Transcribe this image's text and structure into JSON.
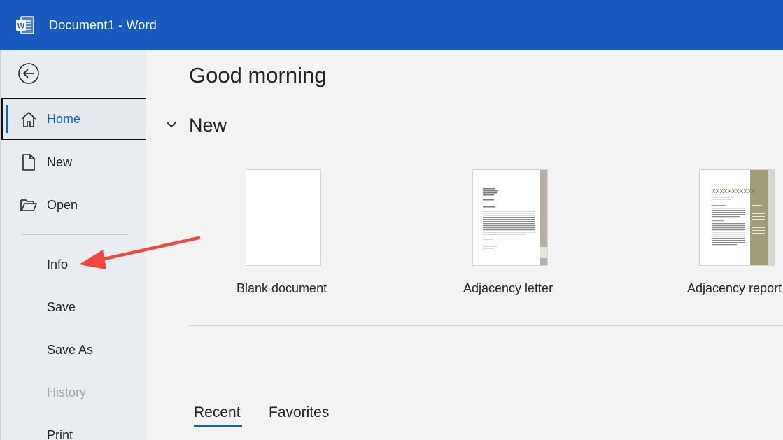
{
  "window": {
    "title": "Document1  -  Word"
  },
  "sidebar": {
    "items": [
      {
        "label": "Home",
        "icon": "home-icon"
      },
      {
        "label": "New",
        "icon": "new-document-icon"
      },
      {
        "label": "Open",
        "icon": "folder-open-icon"
      },
      {
        "label": "Info"
      },
      {
        "label": "Save"
      },
      {
        "label": "Save As"
      },
      {
        "label": "History"
      },
      {
        "label": "Print"
      }
    ]
  },
  "main": {
    "greeting": "Good morning",
    "new_section": "New",
    "templates": [
      {
        "label": "Blank document"
      },
      {
        "label": "Adjacency letter"
      },
      {
        "label": "Adjacency report"
      }
    ],
    "report_thumb_heading": "XXXXXXXXXXX",
    "tabs": [
      {
        "label": "Recent"
      },
      {
        "label": "Favorites"
      }
    ]
  },
  "colors": {
    "accent": "#185abd",
    "annotation_arrow": "#f0473f",
    "report_band": "#a09e78"
  }
}
